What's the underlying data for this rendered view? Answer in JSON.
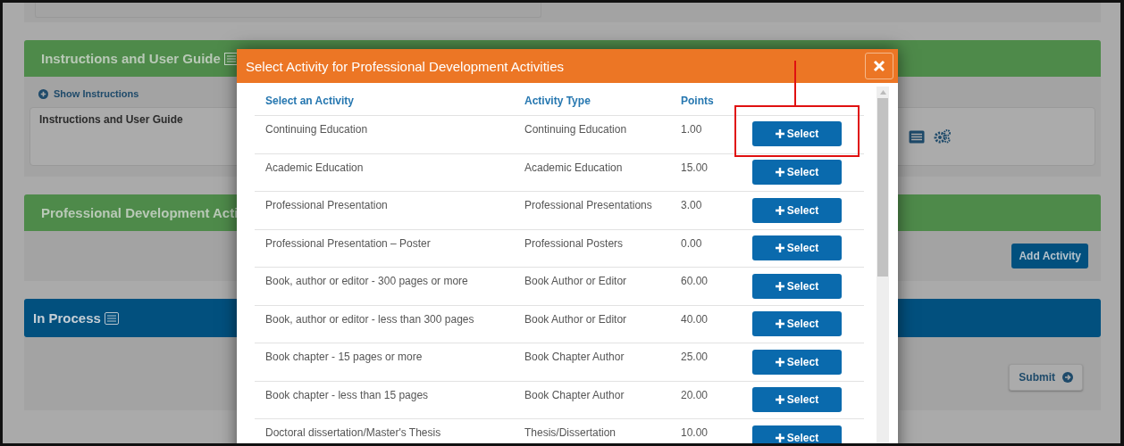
{
  "page": {
    "instructions_panel": {
      "title": "Instructions and User Guide",
      "toggle": "Show Instructions",
      "box_text": "Instructions and User Guide"
    },
    "activities_panel": {
      "title": "Professional Development Acti",
      "button": "Add Activity"
    },
    "in_process_panel": {
      "title": "In Process",
      "button": "Submit"
    }
  },
  "modal": {
    "title": "Select Activity for Professional Development Activities",
    "columns": [
      "Select an Activity",
      "Activity Type",
      "Points"
    ],
    "rows": [
      {
        "activity": "Continuing Education",
        "type": "Continuing Education",
        "points": "1.00",
        "button": "Select",
        "highlighted": true
      },
      {
        "activity": "Academic Education",
        "type": "Academic Education",
        "points": "15.00",
        "button": "Select",
        "highlighted": false
      },
      {
        "activity": "Professional Presentation",
        "type": "Professional Presentations",
        "points": "3.00",
        "button": "Select",
        "highlighted": false
      },
      {
        "activity": "Professional Presentation – Poster",
        "type": "Professional Posters",
        "points": "0.00",
        "button": "Select",
        "highlighted": false
      },
      {
        "activity": "Book, author or editor - 300 pages or more",
        "type": "Book Author or Editor",
        "points": "60.00",
        "button": "Select",
        "highlighted": false
      },
      {
        "activity": "Book, author or editor - less than 300 pages",
        "type": "Book Author or Editor",
        "points": "40.00",
        "button": "Select",
        "highlighted": false
      },
      {
        "activity": "Book chapter - 15 pages or more",
        "type": "Book Chapter Author",
        "points": "25.00",
        "button": "Select",
        "highlighted": false
      },
      {
        "activity": "Book chapter - less than 15 pages",
        "type": "Book Chapter Author",
        "points": "20.00",
        "button": "Select",
        "highlighted": false
      },
      {
        "activity": "Doctoral dissertation/Master's Thesis",
        "type": "Thesis/Dissertation",
        "points": "10.00",
        "button": "Select",
        "highlighted": false
      }
    ]
  }
}
